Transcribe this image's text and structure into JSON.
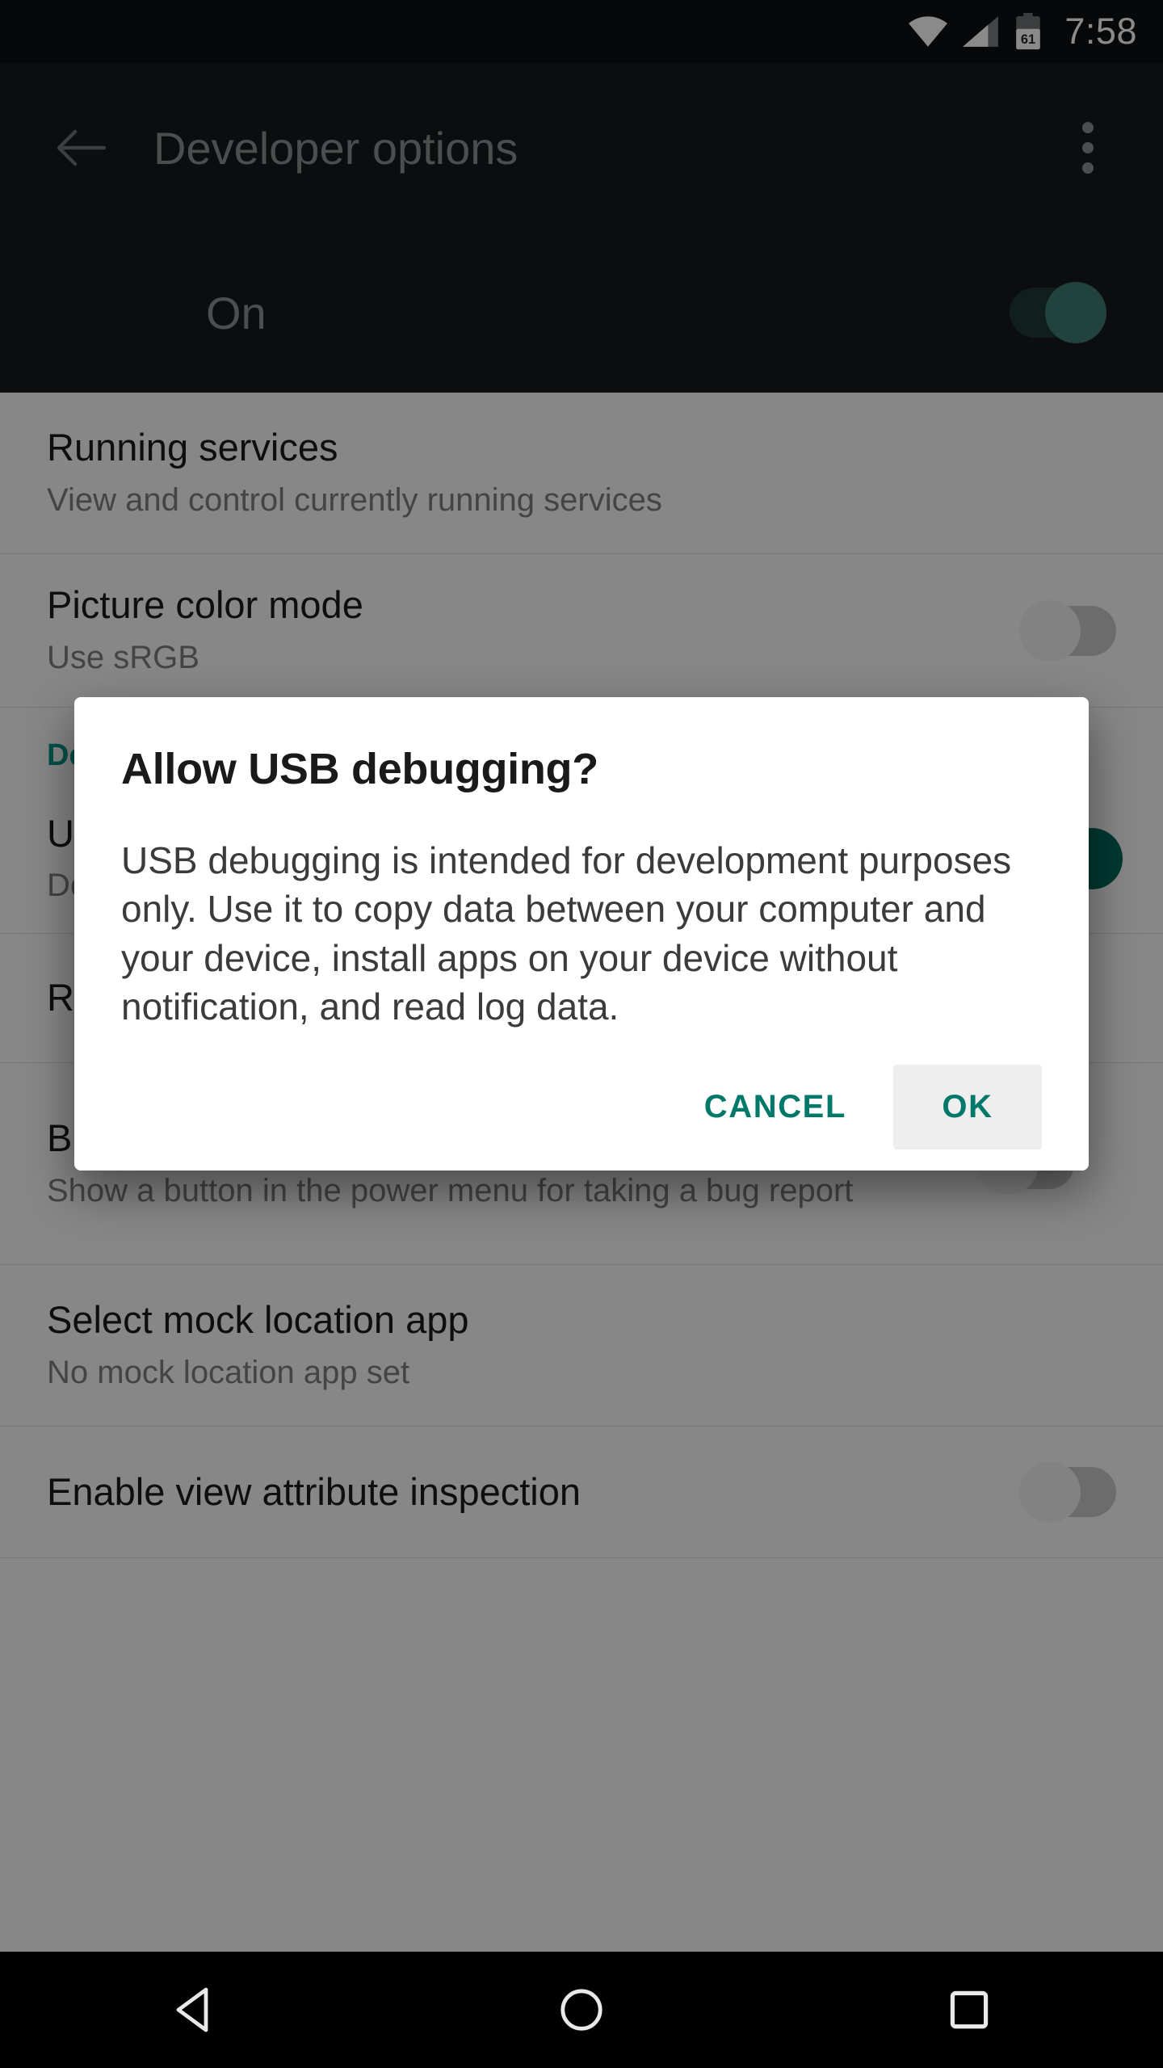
{
  "status_bar": {
    "wifi_icon": "wifi-icon",
    "signal_icon": "cell-signal-icon",
    "battery_icon": "battery-icon",
    "battery_level": "61",
    "time": "7:58"
  },
  "app_bar": {
    "back_icon": "back-arrow-icon",
    "title": "Developer options",
    "overflow_icon": "overflow-menu-icon"
  },
  "master_switch": {
    "label": "On",
    "state": "on"
  },
  "settings": [
    {
      "title": "Running services",
      "subtitle": "View and control currently running services",
      "control": "none"
    },
    {
      "title": "Picture color mode",
      "subtitle": "Use sRGB",
      "control": "switch",
      "state": "off"
    },
    {
      "section": "Debugging"
    },
    {
      "title": "USB debugging",
      "subtitle": "Debug mode when USB is connected",
      "control": "switch",
      "state": "on"
    },
    {
      "title": "Revoke USB debugging authorizations",
      "subtitle": "",
      "control": "none"
    },
    {
      "title": "Bug report shortcut",
      "subtitle": "Show a button in the power menu for taking a bug report",
      "control": "switch",
      "state": "off"
    },
    {
      "title": "Select mock location app",
      "subtitle": "No mock location app set",
      "control": "none"
    },
    {
      "title": "Enable view attribute inspection",
      "subtitle": "",
      "control": "switch",
      "state": "off"
    }
  ],
  "dialog": {
    "title": "Allow USB debugging?",
    "body": "USB debugging is intended for development purposes only. Use it to copy data between your computer and your device, install apps on your device without notification, and read log data.",
    "cancel_label": "CANCEL",
    "ok_label": "OK"
  },
  "nav_bar": {
    "back_icon": "nav-back-triangle-icon",
    "home_icon": "nav-home-circle-icon",
    "recents_icon": "nav-recents-square-icon"
  },
  "colors": {
    "accent_teal": "#00796b",
    "status_bar_bg": "#0d1011",
    "app_bar_bg": "#15191b",
    "list_bg": "#fafafa",
    "section_header": "#009688"
  }
}
